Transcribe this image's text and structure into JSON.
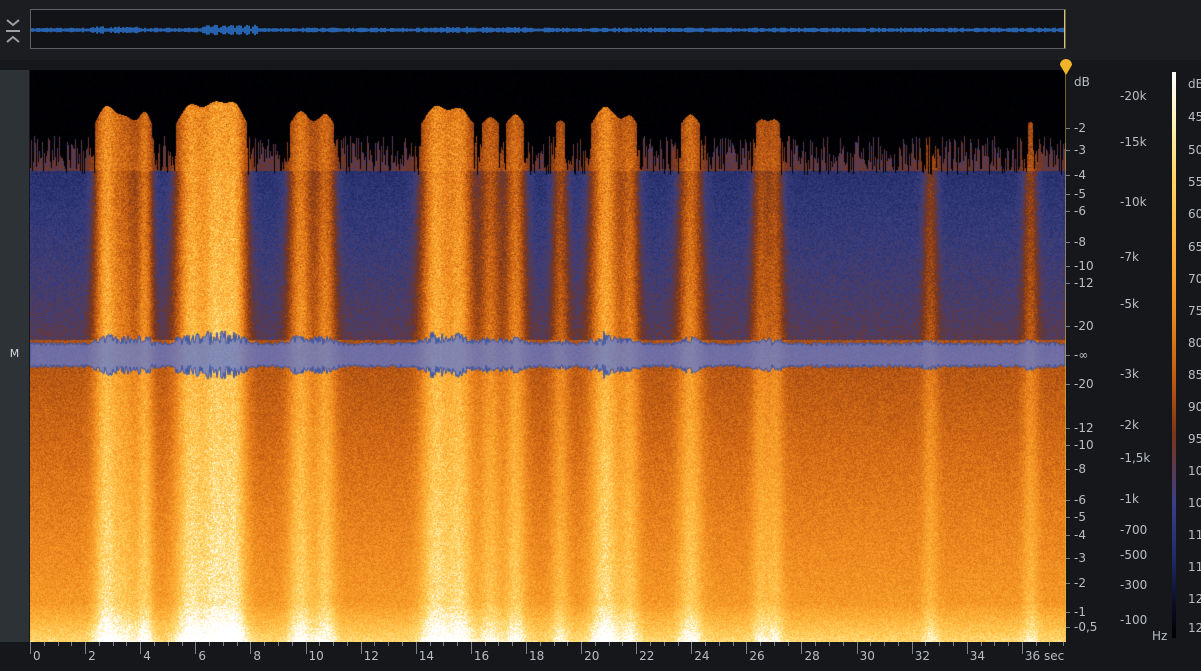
{
  "channel_label": "M",
  "db_axis": {
    "unit": "dB",
    "ticks": [
      {
        "label": "-2",
        "y": 0.102
      },
      {
        "label": "-3",
        "y": 0.14
      },
      {
        "label": "-4",
        "y": 0.184
      },
      {
        "label": "-5",
        "y": 0.217
      },
      {
        "label": "-6",
        "y": 0.247
      },
      {
        "label": "-8",
        "y": 0.3
      },
      {
        "label": "-10",
        "y": 0.342
      },
      {
        "label": "-12",
        "y": 0.372
      },
      {
        "label": "-20",
        "y": 0.448
      },
      {
        "label": "-∞",
        "y": 0.499
      },
      {
        "label": "-20",
        "y": 0.549
      },
      {
        "label": "-12",
        "y": 0.626
      },
      {
        "label": "-10",
        "y": 0.656
      },
      {
        "label": "-8",
        "y": 0.697
      },
      {
        "label": "-6",
        "y": 0.751
      },
      {
        "label": "-5",
        "y": 0.781
      },
      {
        "label": "-4",
        "y": 0.813
      },
      {
        "label": "-3",
        "y": 0.853
      },
      {
        "label": "-2",
        "y": 0.897
      },
      {
        "label": "-1",
        "y": 0.948
      },
      {
        "label": "-0,5",
        "y": 0.973
      }
    ]
  },
  "hz_axis": {
    "unit": "Hz",
    "ticks": [
      {
        "label": "-20k",
        "y": 0.046
      },
      {
        "label": "-15k",
        "y": 0.126
      },
      {
        "label": "-10k",
        "y": 0.231
      },
      {
        "label": "-7k",
        "y": 0.327
      },
      {
        "label": "-5k",
        "y": 0.409
      },
      {
        "label": "-3k",
        "y": 0.532
      },
      {
        "label": "-2k",
        "y": 0.621
      },
      {
        "label": "-1,5k",
        "y": 0.679
      },
      {
        "label": "-1k",
        "y": 0.75
      },
      {
        "label": "-700",
        "y": 0.804
      },
      {
        "label": "-500",
        "y": 0.848
      },
      {
        "label": "-300",
        "y": 0.9
      },
      {
        "label": "-100",
        "y": 0.962
      }
    ]
  },
  "time_axis": {
    "unit": "sec",
    "max": 37.6,
    "ticks": [
      0,
      2,
      4,
      6,
      8,
      10,
      12,
      14,
      16,
      18,
      20,
      22,
      24,
      26,
      28,
      30,
      32,
      34,
      36
    ]
  },
  "colorbar": {
    "unit": "dB",
    "labels": [
      {
        "label": "45",
        "y": 0.083
      },
      {
        "label": "50",
        "y": 0.14
      },
      {
        "label": "55",
        "y": 0.196
      },
      {
        "label": "60",
        "y": 0.252
      },
      {
        "label": "65",
        "y": 0.309
      },
      {
        "label": "70",
        "y": 0.365
      },
      {
        "label": "75",
        "y": 0.421
      },
      {
        "label": "80",
        "y": 0.477
      },
      {
        "label": "85",
        "y": 0.533
      },
      {
        "label": "90",
        "y": 0.589
      },
      {
        "label": "95",
        "y": 0.645
      },
      {
        "label": "10",
        "y": 0.701
      },
      {
        "label": "10",
        "y": 0.757
      },
      {
        "label": "11",
        "y": 0.813
      },
      {
        "label": "11",
        "y": 0.869
      },
      {
        "label": "12",
        "y": 0.925
      },
      {
        "label": "12",
        "y": 0.975
      }
    ]
  },
  "colors": {
    "waveform": "#5a78d6",
    "overview_waveform": "#2f7de0",
    "playhead": "#f0b429",
    "background": "#15171a"
  },
  "icons": {
    "collapse": "collapse-chevrons-icon",
    "playhead": "playhead-pin-icon"
  }
}
